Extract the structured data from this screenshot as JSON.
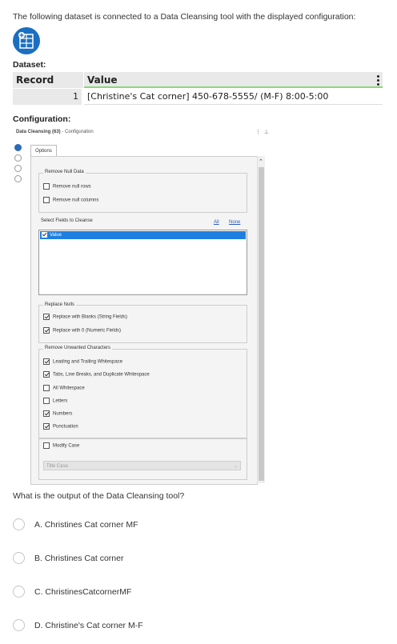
{
  "intro": "The following dataset is connected to a Data Cleansing tool with the displayed configuration:",
  "dataset_label": "Dataset:",
  "table": {
    "headers": [
      "Record",
      "Value"
    ],
    "rows": [
      {
        "record": "1",
        "value": "[Christine's Cat corner] 450-678-5555/ (M-F) 8:00-5:00"
      }
    ]
  },
  "configuration_label": "Configuration:",
  "config": {
    "title": "Data Cleansing (63)",
    "title_suffix": "- Configuration",
    "tab": "Options",
    "remove_null_data": {
      "label": "Remove Null Data",
      "items": [
        {
          "label": "Remove null rows",
          "checked": false
        },
        {
          "label": "Remove null columns",
          "checked": false
        }
      ]
    },
    "select_fields_label": "Select Fields to Cleanse",
    "all_link": "All",
    "none_link": "None",
    "fields": [
      {
        "label": "Value",
        "checked": true
      }
    ],
    "replace_nulls": {
      "label": "Replace Nulls",
      "items": [
        {
          "label": "Replace with Blanks (String Fields)",
          "checked": true
        },
        {
          "label": "Replace with 0 (Numeric Fields)",
          "checked": true
        }
      ]
    },
    "remove_unwanted": {
      "label": "Remove Unwanted Characters",
      "items": [
        {
          "label": "Leading and Trailing Whitespace",
          "checked": true
        },
        {
          "label": "Tabs, Line Breaks, and Duplicate Whitespace",
          "checked": true
        },
        {
          "label": "All Whitespace",
          "checked": false
        },
        {
          "label": "Letters",
          "checked": false
        },
        {
          "label": "Numbers",
          "checked": true
        },
        {
          "label": "Punctuation",
          "checked": true
        }
      ]
    },
    "modify_case": {
      "label": "Modify Case",
      "checked": false,
      "select_value": "Title Case"
    }
  },
  "question": "What is the output of the Data Cleansing tool?",
  "options": [
    "A. Christines Cat corner MF",
    "B. Christines Cat corner",
    "C. ChristinesCatcornerMF",
    "D. Christine's Cat corner M-F"
  ]
}
